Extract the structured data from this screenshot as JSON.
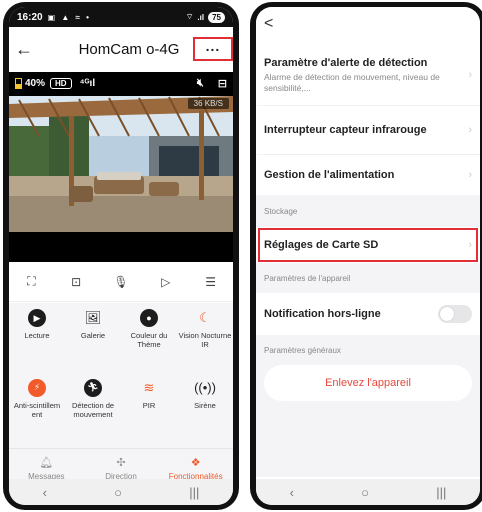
{
  "left": {
    "status": {
      "time": "16:20",
      "notif_icons": "▣ ▲ ≈ •",
      "battery": "75"
    },
    "header": {
      "back": "←",
      "title": "HomCam o-4G",
      "more": "..."
    },
    "video": {
      "battery_pct": "40%",
      "hd": "HD",
      "signal": "⁴ᴳıl",
      "speed": "36 KB/S"
    },
    "features": [
      {
        "label": "Lecture"
      },
      {
        "label": "Galerie"
      },
      {
        "label": "Couleur du Thème"
      },
      {
        "label": "Vision Nocturne IR"
      },
      {
        "label": "Anti-scintillem ent"
      },
      {
        "label": "Détection de mouvement"
      },
      {
        "label": "PIR"
      },
      {
        "label": "Sirène"
      }
    ],
    "tabs": [
      {
        "label": "Messages"
      },
      {
        "label": "Direction"
      },
      {
        "label": "Fonctionnalités"
      }
    ],
    "nav": {
      "back": "‹",
      "home": "○",
      "recents": "|||"
    },
    "accent": "#f15a2b"
  },
  "right": {
    "back": "<",
    "items": {
      "alert_title": "Paramètre d'alerte de détection",
      "alert_sub": "Alarme de détection de mouvement, niveau de sensibilité,...",
      "ir_switch": "Interrupteur capteur infrarouge",
      "power": "Gestion de l'alimentation",
      "storage_section": "Stockage",
      "sd_card": "Réglages de Carte SD",
      "device_section": "Paramètres de l'appareil",
      "offline_notif": "Notification hors-ligne",
      "general_section": "Paramètres généraux",
      "remove": "Enlevez l'appareil"
    },
    "offline_toggle_on": false,
    "nav": {
      "back": "‹",
      "home": "○",
      "recents": "|||"
    },
    "highlight_color": "#e03035"
  }
}
